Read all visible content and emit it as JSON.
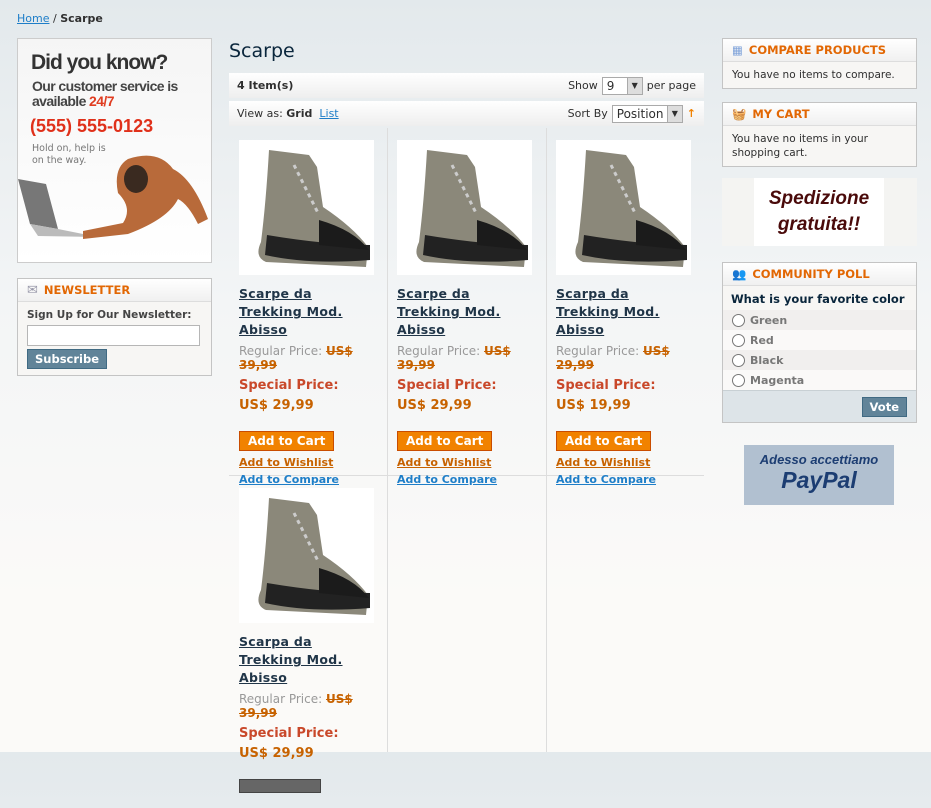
{
  "breadcrumb": {
    "home": "Home",
    "sep": "/",
    "current": "Scarpe"
  },
  "banner": {
    "title": "Did you know?",
    "line1": "Our customer service is",
    "line2a": "available ",
    "line2b": "24/7",
    "phone": "(555) 555-0123",
    "hold1": "Hold on, help is",
    "hold2": "on the way."
  },
  "newsletter": {
    "title": "NEWSLETTER",
    "label": "Sign Up for Our Newsletter:",
    "value": "",
    "button": "Subscribe"
  },
  "main": {
    "title": "Scarpe",
    "count": "4 Item(s)",
    "show_label": "Show",
    "show_value": "9",
    "per_page": "per page",
    "view_as": "View as:",
    "grid": "Grid",
    "list": "List",
    "sort_by": "Sort By",
    "sort_value": "Position",
    "sort_dir_icon": "arrow-up-icon"
  },
  "products": [
    {
      "name": "Scarpe da Trekking Mod. Abisso",
      "regular_label": "Regular Price:",
      "regular": "US$ 39,99",
      "special_label": "Special Price:",
      "special": "US$ 29,99",
      "cart": "Add to Cart",
      "wishlist": "Add to Wishlist",
      "compare": "Add to Compare"
    },
    {
      "name": "Scarpe da Trekking Mod. Abisso",
      "regular_label": "Regular Price:",
      "regular": "US$ 39,99",
      "special_label": "Special Price:",
      "special": "US$ 29,99",
      "cart": "Add to Cart",
      "wishlist": "Add to Wishlist",
      "compare": "Add to Compare"
    },
    {
      "name": "Scarpa da Trekking Mod. Abisso",
      "regular_label": "Regular Price:",
      "regular": "US$ 29,99",
      "special_label": "Special Price:",
      "special": "US$ 19,99",
      "cart": "Add to Cart",
      "wishlist": "Add to Wishlist",
      "compare": "Add to Compare"
    },
    {
      "name": "Scarpa da Trekking Mod. Abisso",
      "regular_label": "Regular Price:",
      "regular": "US$ 39,99",
      "special_label": "Special Price:",
      "special": "US$ 29,99"
    }
  ],
  "compare": {
    "title": "COMPARE PRODUCTS",
    "text": "You have no items to compare."
  },
  "cart": {
    "title": "MY CART",
    "text": "You have no items in your shopping cart."
  },
  "promo": {
    "line1": "Spedizione",
    "line2": "gratuita!!"
  },
  "poll": {
    "title": "COMMUNITY POLL",
    "question": "What is your favorite color",
    "options": [
      "Green",
      "Red",
      "Black",
      "Magenta"
    ],
    "button": "Vote"
  },
  "paypal": {
    "line1": "Adesso accettiamo",
    "line2": "PayPal"
  },
  "colors": {
    "accent": "#e26703",
    "button": "#f18200",
    "link": "#1e7ec8",
    "title": "#0a263c"
  }
}
